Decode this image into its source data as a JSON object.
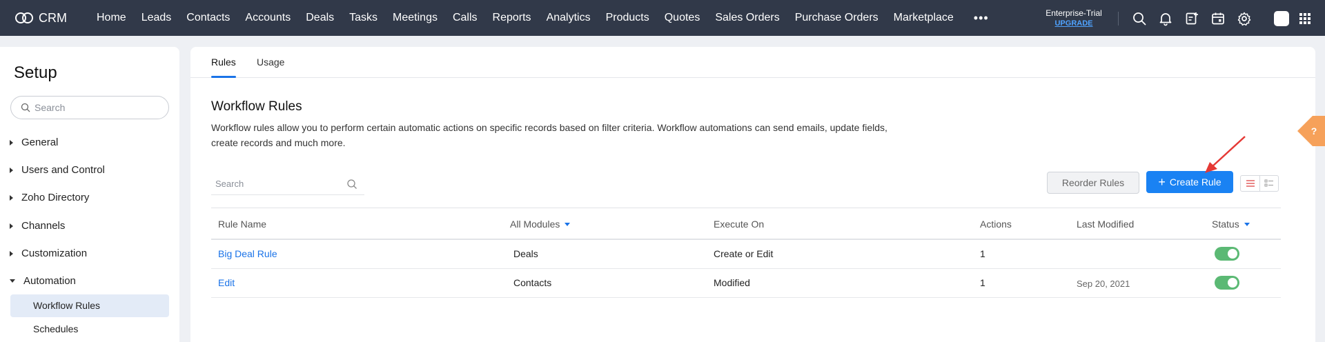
{
  "topbar": {
    "brand": "CRM",
    "nav": [
      "Home",
      "Leads",
      "Contacts",
      "Accounts",
      "Deals",
      "Tasks",
      "Meetings",
      "Calls",
      "Reports",
      "Analytics",
      "Products",
      "Quotes",
      "Sales Orders",
      "Purchase Orders",
      "Marketplace"
    ],
    "more": "•••",
    "trial_label": "Enterprise-Trial",
    "upgrade_label": "UPGRADE",
    "icons": [
      "search-icon",
      "bell-icon",
      "add-note-icon",
      "calendar-icon",
      "gear-icon",
      "avatar",
      "apps-grid-icon"
    ]
  },
  "sidebar": {
    "title": "Setup",
    "search_placeholder": "Search",
    "sections": [
      "General",
      "Users and Control",
      "Zoho Directory",
      "Channels",
      "Customization",
      "Automation"
    ],
    "automation_items": [
      "Workflow Rules",
      "Schedules"
    ]
  },
  "main": {
    "tabs": [
      "Rules",
      "Usage"
    ],
    "title": "Workflow Rules",
    "description": "Workflow rules allow you to perform certain automatic actions on specific records based on filter criteria. Workflow automations can send emails, update fields, create records and much more.",
    "search_placeholder": "Search",
    "reorder_label": "Reorder Rules",
    "create_label": "Create Rule",
    "help_label": "?"
  },
  "table": {
    "headers": {
      "rule_name": "Rule Name",
      "modules": "All Modules",
      "execute_on": "Execute On",
      "actions": "Actions",
      "last_modified": "Last Modified",
      "status": "Status"
    },
    "rows": [
      {
        "name": "Big Deal Rule",
        "module": "Deals",
        "execute_on": "Create or Edit",
        "actions": "1",
        "last_modified": "",
        "status": "on"
      },
      {
        "name": "Edit",
        "module": "Contacts",
        "execute_on": "Modified",
        "actions": "1",
        "last_modified": "Sep 20, 2021",
        "status": "on"
      }
    ]
  },
  "colors": {
    "topbar": "#313949",
    "accent": "#1a82f3",
    "toggle_on": "#5bb974",
    "help_tab": "#f6a15a",
    "arrow": "#e53935"
  }
}
